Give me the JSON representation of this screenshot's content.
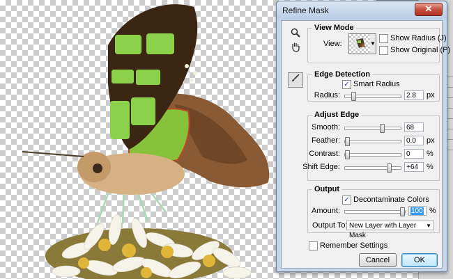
{
  "dialog": {
    "title": "Refine Mask",
    "close_glyph": "✕",
    "tools": {
      "zoom": "zoom-icon",
      "hand": "hand-icon",
      "refine": "refine-radius-brush-icon"
    },
    "view_mode": {
      "title": "View Mode",
      "view_label": "View:",
      "show_radius": {
        "label": "Show Radius (J)",
        "checked": false
      },
      "show_original": {
        "label": "Show Original (P)",
        "checked": false
      }
    },
    "edge_detection": {
      "title": "Edge Detection",
      "smart_radius": {
        "label": "Smart Radius",
        "checked": true
      },
      "radius": {
        "label": "Radius:",
        "value": "2.8",
        "unit": "px",
        "slider": 0.12
      }
    },
    "adjust_edge": {
      "title": "Adjust Edge",
      "smooth": {
        "label": "Smooth:",
        "value": "68",
        "unit": "",
        "slider": 0.68
      },
      "feather": {
        "label": "Feather:",
        "value": "0.0",
        "unit": "px",
        "slider": 0.0
      },
      "contrast": {
        "label": "Contrast:",
        "value": "0",
        "unit": "%",
        "slider": 0.0
      },
      "shift_edge": {
        "label": "Shift Edge:",
        "value": "+64",
        "unit": "%",
        "slider": 0.82
      }
    },
    "output": {
      "title": "Output",
      "decontaminate": {
        "label": "Decontaminate Colors",
        "checked": true
      },
      "amount": {
        "label": "Amount:",
        "value": "100",
        "unit": "%",
        "slider": 1.0
      },
      "output_to": {
        "label": "Output To:",
        "value": "New Layer with Layer Mask"
      }
    },
    "remember": {
      "label": "Remember Settings",
      "checked": false
    },
    "cancel_label": "Cancel",
    "ok_label": "OK"
  },
  "colors": {
    "checker": "#cccccc",
    "dialog_frame": "#c7d7ea",
    "close_button": "#c3493a",
    "selection": "#3399ff"
  }
}
